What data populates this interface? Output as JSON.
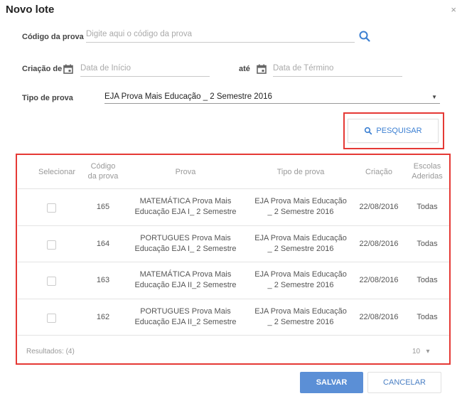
{
  "dialog": {
    "title": "Novo lote",
    "close_glyph": "×"
  },
  "filters": {
    "codigo_label": "Código da prova",
    "codigo_placeholder": "Digite aqui o código da prova",
    "criacao_label": "Criação de",
    "inicio_placeholder": "Data de Início",
    "ate_label": "até",
    "termino_placeholder": "Data de Término",
    "tipo_label": "Tipo de prova",
    "tipo_selected": "EJA Prova Mais Educação _ 2 Semestre 2016",
    "search_button": "PESQUISAR"
  },
  "table": {
    "headers": {
      "selecionar": "Selecionar",
      "codigo_l1": "Código",
      "codigo_l2": "da prova",
      "prova": "Prova",
      "tipo": "Tipo de prova",
      "criacao": "Criação",
      "escolas_l1": "Escolas",
      "escolas_l2": "Aderidas"
    },
    "rows": [
      {
        "codigo": "165",
        "prova_l1": "MATEMÁTICA Prova Mais",
        "prova_l2": "Educação EJA I_ 2 Semestre",
        "tipo_l1": "EJA Prova Mais Educação",
        "tipo_l2": "_ 2 Semestre 2016",
        "criacao": "22/08/2016",
        "escolas": "Todas"
      },
      {
        "codigo": "164",
        "prova_l1": "PORTUGUES Prova Mais",
        "prova_l2": "Educação EJA I_ 2 Semestre",
        "tipo_l1": "EJA Prova Mais Educação",
        "tipo_l2": "_ 2 Semestre 2016",
        "criacao": "22/08/2016",
        "escolas": "Todas"
      },
      {
        "codigo": "163",
        "prova_l1": "MATEMÁTICA Prova Mais",
        "prova_l2": "Educação EJA II_2 Semestre",
        "tipo_l1": "EJA Prova Mais Educação",
        "tipo_l2": "_ 2 Semestre 2016",
        "criacao": "22/08/2016",
        "escolas": "Todas"
      },
      {
        "codigo": "162",
        "prova_l1": "PORTUGUES Prova Mais",
        "prova_l2": "Educação EJA II_2 Semestre",
        "tipo_l1": "EJA Prova Mais Educação",
        "tipo_l2": "_ 2 Semestre 2016",
        "criacao": "22/08/2016",
        "escolas": "Todas"
      }
    ],
    "results_text": "Resultados: (4)",
    "page_size": "10",
    "page_size_caret": "▾"
  },
  "actions": {
    "save": "SALVAR",
    "cancel": "CANCELAR"
  },
  "colors": {
    "accent": "#3b7fd2",
    "highlight": "#e53935",
    "save_bg": "#5b8fd6"
  }
}
